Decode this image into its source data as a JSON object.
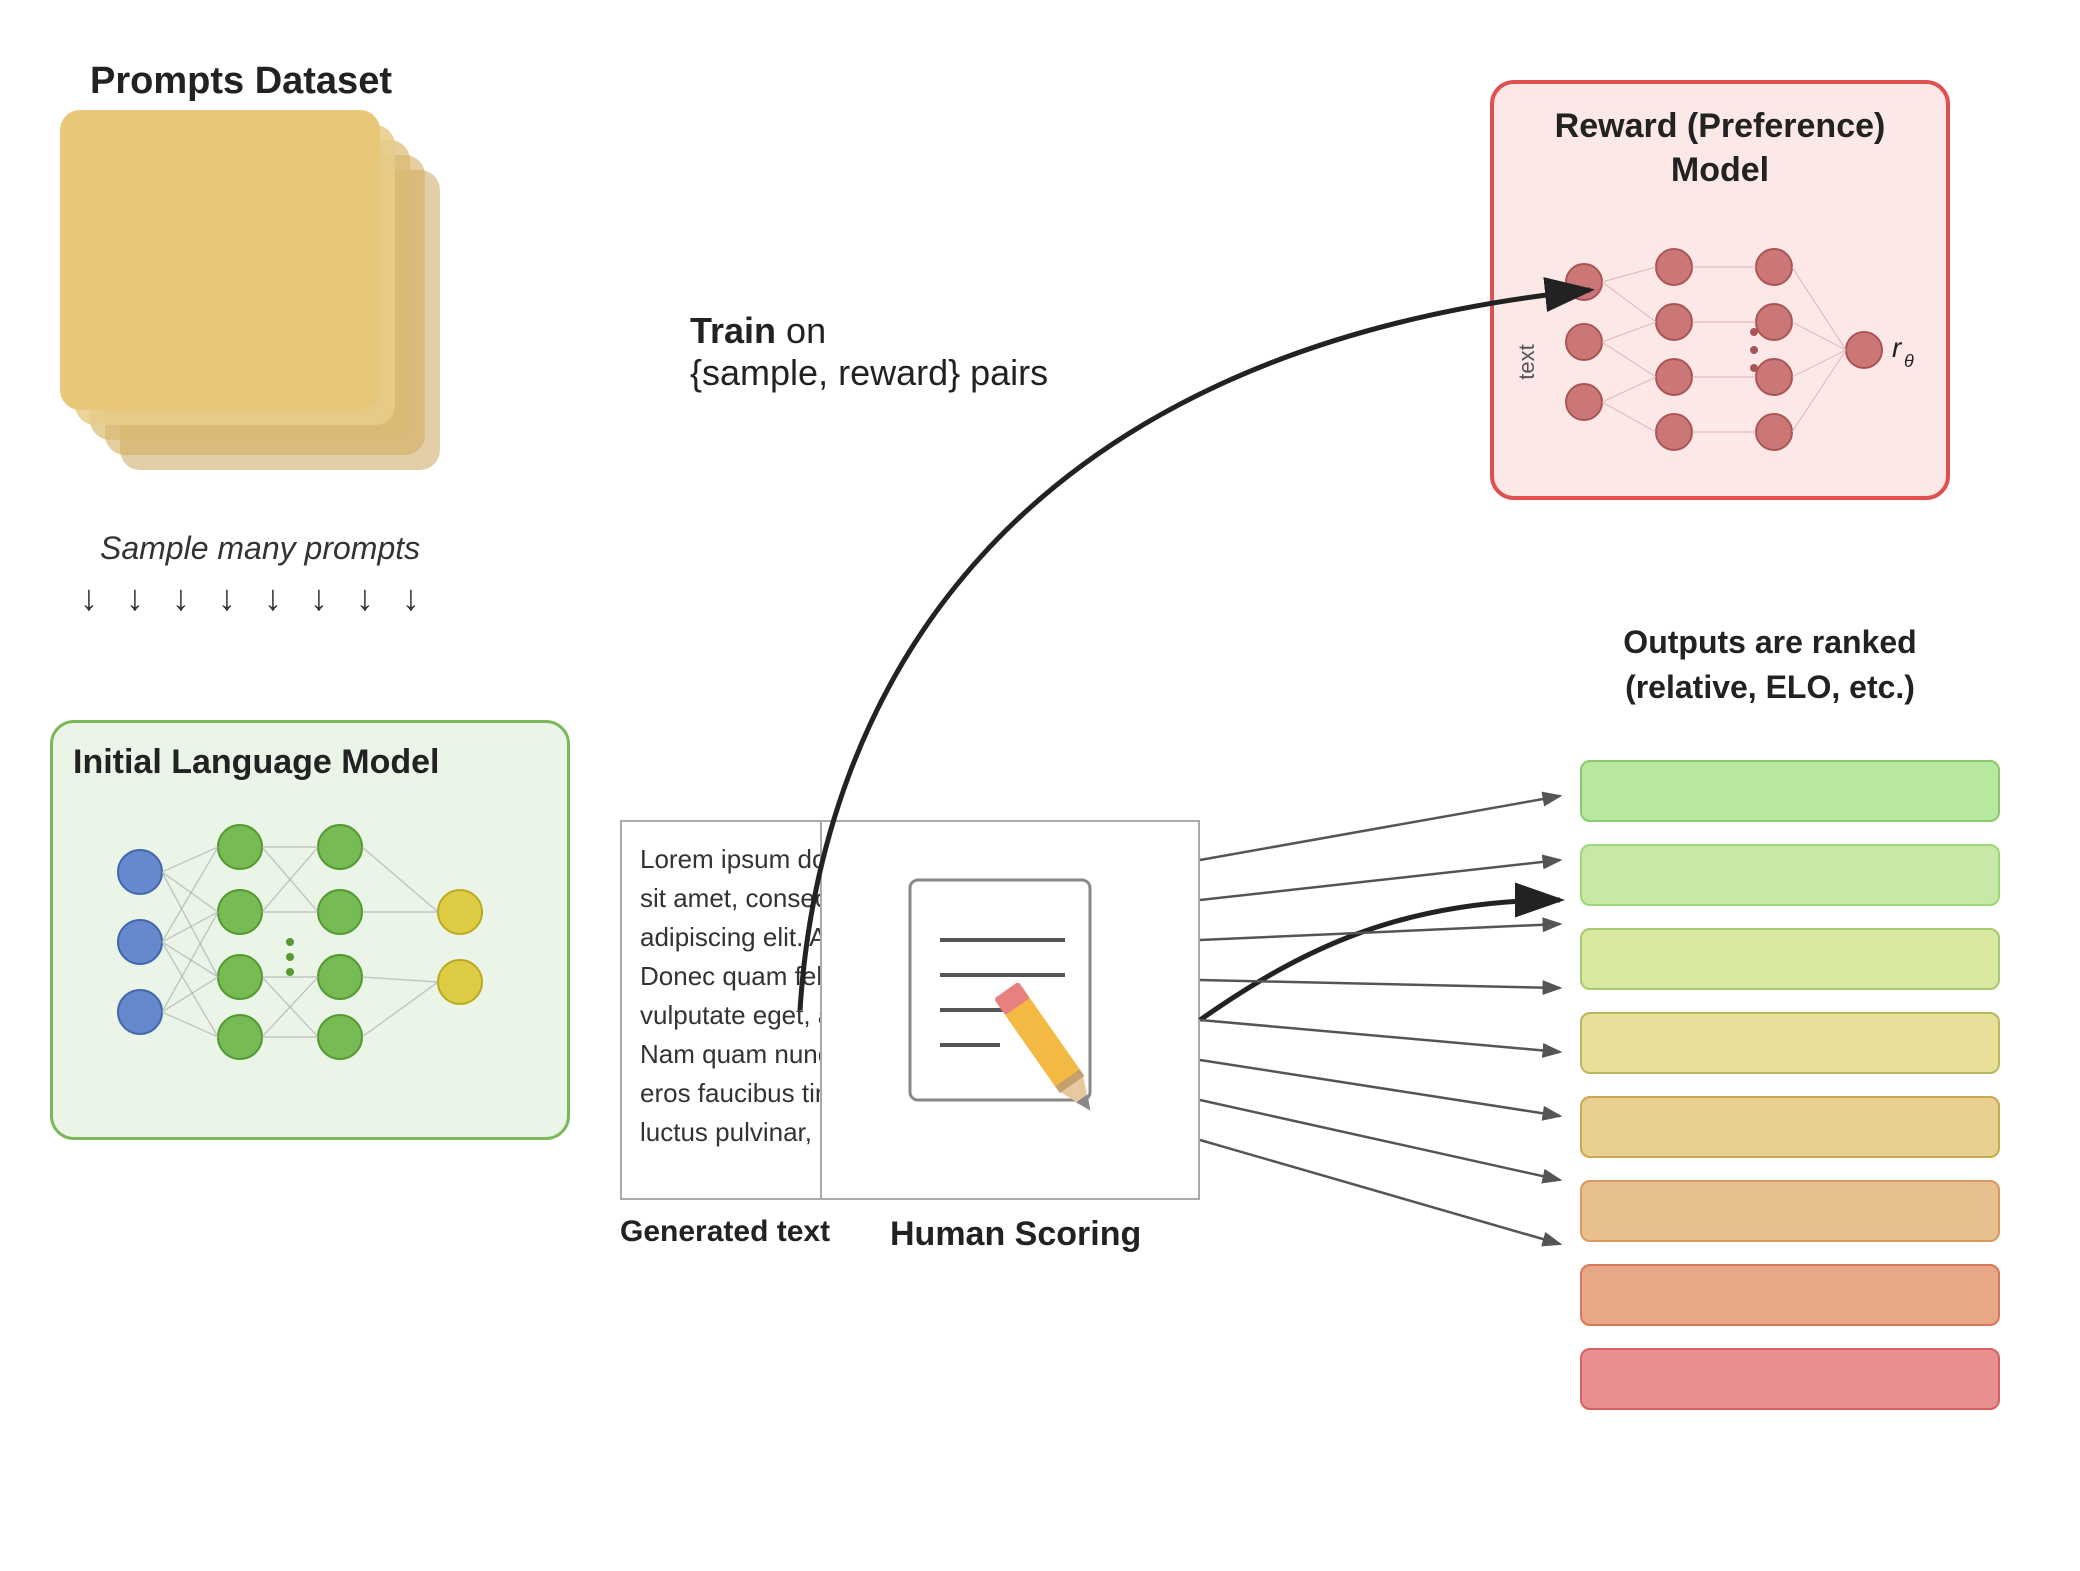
{
  "prompts_dataset": {
    "label": "Prompts Dataset",
    "paper_colors": [
      "#e8c98a",
      "#deb96a",
      "#d4a94a",
      "#cab93a"
    ]
  },
  "sample_prompts": {
    "label": "Sample many prompts"
  },
  "ilm": {
    "label": "Initial Language Model"
  },
  "reward_model": {
    "title_line1": "Reward (Preference)",
    "title_line2": "Model",
    "r_theta": "rθ"
  },
  "train": {
    "bold": "Train",
    "rest": " on\n{sample, reward} pairs"
  },
  "generated_text": {
    "content": "Lorem ipsum dolor\nsit amet, consecte\nadipiscing elit. Aen.\nDonec quam felis\nvulputate eget, arc.\nNam quam nunc\neros faucibus tincid.\nluctus pulvinar, her.",
    "label": "Generated text"
  },
  "human_scoring": {
    "label": "Human Scoring"
  },
  "outputs_ranked": {
    "label": "Outputs are ranked\n(relative, ELO, etc.)",
    "bars": [
      {
        "color": "#b8e8a0",
        "border": "#8cc870"
      },
      {
        "color": "#c8e8a8",
        "border": "#9cd878"
      },
      {
        "color": "#d8e8a0",
        "border": "#a8c870"
      },
      {
        "color": "#e8e098",
        "border": "#b8b860"
      },
      {
        "color": "#e8d090",
        "border": "#c8a850"
      },
      {
        "color": "#e8c090",
        "border": "#d89860"
      },
      {
        "color": "#e8a888",
        "border": "#d87858"
      },
      {
        "color": "#e89090",
        "border": "#d86060"
      }
    ]
  },
  "down_arrows": {
    "count": 8
  }
}
